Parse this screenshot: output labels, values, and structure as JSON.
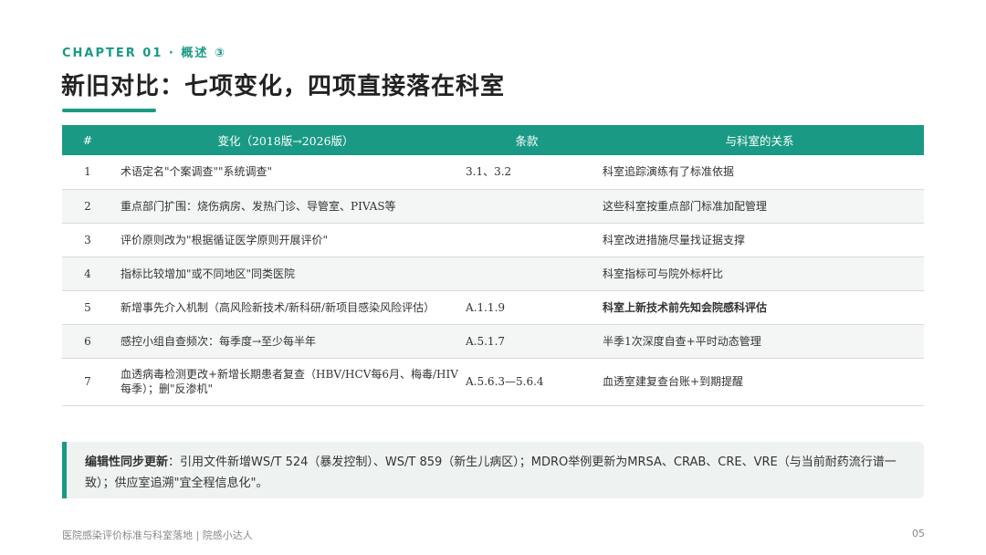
{
  "header": {
    "eyebrow": "CHAPTER 01 · 概述 ③",
    "title": "新旧对比：七项变化，四项直接落在科室"
  },
  "table": {
    "columns": [
      "#",
      "变化（2018版→2026版）",
      "条款",
      "与科室的关系"
    ],
    "rows": [
      {
        "num": "1",
        "change": "术语定名\"个案调查\"\"系统调查\"",
        "clause": "3.1、3.2",
        "relation": "科室追踪演练有了标准依据"
      },
      {
        "num": "2",
        "change": "重点部门扩围：烧伤病房、发热门诊、导管室、PIVAS等",
        "clause": "",
        "relation": "这些科室按重点部门标准加配管理"
      },
      {
        "num": "3",
        "change": "评价原则改为\"根据循证医学原则开展评价\"",
        "clause": "",
        "relation": "科室改进措施尽量找证据支撑"
      },
      {
        "num": "4",
        "change": "指标比较增加\"或不同地区\"同类医院",
        "clause": "",
        "relation": "科室指标可与院外标杆比"
      },
      {
        "num": "5",
        "change": "新增事先介入机制（高风险新技术/新科研/新项目感染风险评估）",
        "clause": "A.1.1.9",
        "relation": "科室上新技术前先知会院感科评估"
      },
      {
        "num": "6",
        "change": "感控小组自查频次：每季度→至少每半年",
        "clause": "A.5.1.7",
        "relation": "半季1次深度自查+平时动态管理"
      },
      {
        "num": "7",
        "change": "血透病毒检测更改+新增长期患者复查（HBV/HCV每6月、梅毒/HIV每季）；删\"反渗机\"",
        "clause": "A.5.6.3—5.6.4",
        "relation": "血透室建复查台账+到期提醒"
      }
    ]
  },
  "note": {
    "lead": "编辑性同步更新",
    "text": "：引用文件新增WS/T 524（暴发控制）、WS/T 859（新生儿病区）；MDRO举例更新为MRSA、CRAB、CRE、VRE（与当前耐药流行谱一致）；供应室追溯\"宜全程信息化\"。"
  },
  "footer": {
    "left": "医院感染评价标准与科室落地 | 院感小达人",
    "page": "05"
  },
  "colors": {
    "accent": "#1a9a84",
    "row_alt": "#f3f6f5",
    "note_bg": "#eef3f1"
  }
}
